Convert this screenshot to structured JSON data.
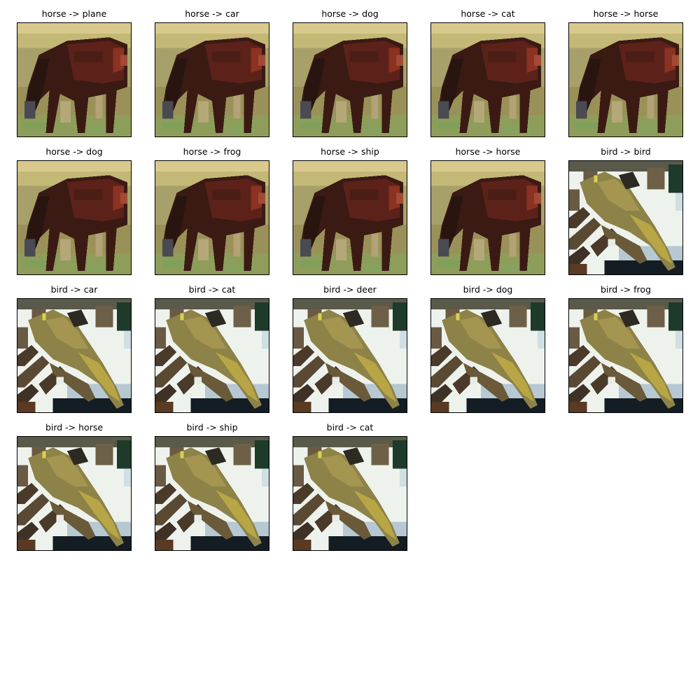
{
  "figure": {
    "panels": [
      {
        "title": "horse -> plane",
        "image": "horse"
      },
      {
        "title": "horse -> car",
        "image": "horse"
      },
      {
        "title": "horse -> dog",
        "image": "horse"
      },
      {
        "title": "horse -> cat",
        "image": "horse"
      },
      {
        "title": "horse -> horse",
        "image": "horse"
      },
      {
        "title": "horse -> dog",
        "image": "horse"
      },
      {
        "title": "horse -> frog",
        "image": "horse"
      },
      {
        "title": "horse -> ship",
        "image": "horse"
      },
      {
        "title": "horse -> horse",
        "image": "horse"
      },
      {
        "title": "bird -> bird",
        "image": "bird"
      },
      {
        "title": "bird -> car",
        "image": "bird"
      },
      {
        "title": "bird -> cat",
        "image": "bird"
      },
      {
        "title": "bird -> deer",
        "image": "bird"
      },
      {
        "title": "bird -> dog",
        "image": "bird"
      },
      {
        "title": "bird -> frog",
        "image": "bird"
      },
      {
        "title": "bird -> horse",
        "image": "bird"
      },
      {
        "title": "bird -> ship",
        "image": "bird"
      },
      {
        "title": "bird -> cat",
        "image": "bird"
      }
    ],
    "colors": {
      "horse_sky": "#d8c88a",
      "horse_grass": "#8c8f52",
      "horse_grass_light": "#a9a86a",
      "horse_body": "#4a1e16",
      "horse_body_red": "#7a2a1c",
      "horse_dark": "#2a1812",
      "bird_bg_white": "#eef3ee",
      "bird_bg_blue": "#b9cbd3",
      "bird_branch": "#5a4a34",
      "bird_body": "#8e8446",
      "bird_body_light": "#b8a650",
      "bird_dark": "#1e2a22",
      "bird_green": "#1d3a2a"
    }
  }
}
